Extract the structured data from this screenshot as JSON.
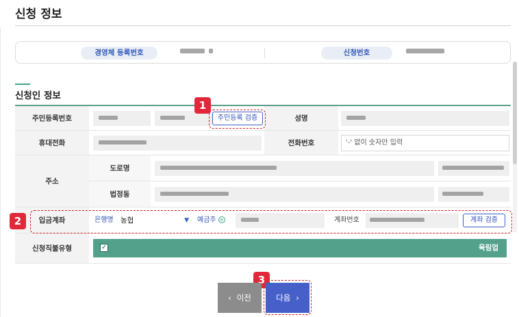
{
  "page": {
    "title": "신청 정보"
  },
  "summary": {
    "business_reg_label": "경영체 등록번호",
    "application_no_label": "신청번호"
  },
  "applicant": {
    "section_title": "신청인 정보",
    "rrn_label": "주민등록번호",
    "rrn_verify_button": "주민등록 검증",
    "name_label": "성명",
    "mobile_label": "휴대전화",
    "phone_label": "전화번호",
    "phone_placeholder": "'-' 없이 숫자만 입력",
    "address_label": "주소",
    "road_label": "도로명",
    "lot_label": "법정동",
    "deposit_label": "입금계좌",
    "bank_label": "은행명",
    "bank_value": "농협",
    "holder_label": "예금주",
    "account_no_label": "계좌번호",
    "account_verify_button": "계좌 검증",
    "payment_type_label": "신청직불유형",
    "payment_type_value": "육림업"
  },
  "nav": {
    "prev_label": "이전",
    "next_label": "다음"
  },
  "annotations": {
    "badge_1": "1",
    "badge_2": "2",
    "badge_3": "3"
  },
  "colors": {
    "accent_blue": "#4760c9",
    "green_bar": "#54a18b",
    "highlight_red": "#e0283a"
  }
}
